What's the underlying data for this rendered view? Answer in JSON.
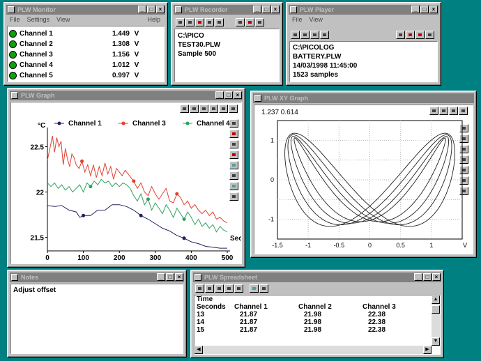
{
  "meter": {
    "title": "PLW Monitor",
    "menu": [
      "File",
      "Settings",
      "View"
    ],
    "menu_right": "Help",
    "channels": [
      {
        "label": "Channel 1",
        "value": "1.449",
        "unit": "V"
      },
      {
        "label": "Channel 2",
        "value": "1.308",
        "unit": "V"
      },
      {
        "label": "Channel 3",
        "value": "1.156",
        "unit": "V"
      },
      {
        "label": "Channel 4",
        "value": "1.012",
        "unit": "V"
      },
      {
        "label": "Channel 5",
        "value": "0.997",
        "unit": "V"
      }
    ]
  },
  "recorder": {
    "title": "PLW Recorder",
    "lines": [
      "C:\\PICO",
      "TEST30.PLW",
      "Sample 500"
    ]
  },
  "player": {
    "title": "PLW Player",
    "menu": [
      "File",
      "View"
    ],
    "lines": [
      "C:\\PICOLOG",
      "BATTERY.PLW",
      "14/03/1998 11:45:00",
      "1523 samples"
    ]
  },
  "graph": {
    "title": "PLW Graph",
    "unit_label": "°C",
    "legend": [
      {
        "name": "Channel 1",
        "color": "#202060"
      },
      {
        "name": "Channel 3",
        "color": "#e04030"
      },
      {
        "name": "Channel 4",
        "color": "#30a060"
      }
    ],
    "x_axis_label": "Sec",
    "chart_data": {
      "type": "line",
      "title": "",
      "xlabel": "Sec",
      "ylabel": "°C",
      "xlim": [
        0,
        500
      ],
      "ylim": [
        21.35,
        22.65
      ],
      "x_ticks": [
        "0",
        "100",
        "200",
        "300",
        "400",
        "500"
      ],
      "y_ticks": [
        "21.5",
        "22",
        "22.5"
      ],
      "series": [
        {
          "name": "Channel 3",
          "color": "#e04030",
          "x": [
            0,
            8,
            14,
            20,
            26,
            32,
            38,
            44,
            50,
            56,
            62,
            68,
            74,
            80,
            88,
            96,
            104,
            112,
            120,
            128,
            136,
            144,
            152,
            160,
            168,
            176,
            184,
            192,
            200,
            208,
            216,
            224,
            232,
            240,
            250,
            260,
            270,
            280,
            290,
            300,
            310,
            320,
            330,
            340,
            350,
            360,
            370,
            380,
            390,
            400,
            410,
            420,
            430,
            440,
            450,
            460,
            470,
            480,
            490,
            500
          ],
          "y": [
            22.35,
            22.5,
            22.62,
            22.44,
            22.6,
            22.5,
            22.56,
            22.3,
            22.48,
            22.36,
            22.28,
            22.42,
            22.38,
            22.3,
            22.26,
            22.34,
            22.22,
            22.3,
            22.18,
            22.3,
            22.16,
            22.28,
            22.18,
            22.32,
            22.2,
            22.28,
            22.14,
            22.26,
            22.22,
            22.18,
            22.24,
            22.2,
            22.16,
            22.12,
            22.04,
            22.1,
            22.0,
            21.96,
            22.06,
            21.98,
            21.92,
            21.98,
            22.04,
            21.9,
            21.88,
            21.98,
            21.94,
            21.86,
            21.9,
            21.82,
            21.86,
            21.8,
            21.76,
            21.8,
            21.74,
            21.78,
            21.7,
            21.72,
            21.68,
            21.66
          ]
        },
        {
          "name": "Channel 4",
          "color": "#30a060",
          "x": [
            0,
            10,
            20,
            30,
            40,
            50,
            60,
            70,
            80,
            90,
            100,
            110,
            120,
            130,
            140,
            150,
            160,
            170,
            180,
            190,
            200,
            210,
            220,
            230,
            240,
            250,
            260,
            270,
            280,
            290,
            300,
            310,
            320,
            330,
            340,
            350,
            360,
            370,
            380,
            390,
            400,
            410,
            420,
            430,
            440,
            450,
            460,
            470,
            480,
            490,
            500
          ],
          "y": [
            22.1,
            22.06,
            22.1,
            22.04,
            22.08,
            22.02,
            22.06,
            22.0,
            22.04,
            22.08,
            22.0,
            22.1,
            22.06,
            22.12,
            22.08,
            22.14,
            22.1,
            22.12,
            22.06,
            22.1,
            22.06,
            22.1,
            22.08,
            22.04,
            21.96,
            21.9,
            21.98,
            21.86,
            21.92,
            21.8,
            21.88,
            21.82,
            21.76,
            21.86,
            21.8,
            21.72,
            21.82,
            21.76,
            21.7,
            21.78,
            21.72,
            21.64,
            21.7,
            21.62,
            21.66,
            21.6,
            21.64,
            21.56,
            21.62,
            21.58,
            21.56
          ]
        },
        {
          "name": "Channel 1",
          "color": "#202060",
          "x": [
            0,
            20,
            40,
            60,
            80,
            90,
            100,
            120,
            140,
            160,
            180,
            200,
            220,
            240,
            260,
            280,
            300,
            320,
            340,
            360,
            380,
            400,
            420,
            440,
            460,
            480,
            500
          ],
          "y": [
            21.85,
            21.84,
            21.85,
            21.8,
            21.78,
            21.72,
            21.74,
            21.74,
            21.8,
            21.8,
            21.86,
            21.86,
            21.84,
            21.8,
            21.74,
            21.7,
            21.65,
            21.6,
            21.57,
            21.52,
            21.49,
            21.45,
            21.43,
            21.4,
            21.39,
            21.38,
            21.38
          ]
        }
      ]
    }
  },
  "xy_graph": {
    "title": "PLW XY Graph",
    "readout": "1.237  0.614",
    "chart_data": {
      "type": "line",
      "title": "",
      "xlabel": "V",
      "ylabel": "",
      "xlim": [
        -1.5,
        1.5
      ],
      "ylim": [
        -1.5,
        1.5
      ],
      "x_ticks": [
        "-1.5",
        "-1",
        "-0.5",
        "0",
        "0.5",
        "1",
        "V"
      ],
      "y_ticks": [
        "1",
        "0",
        "-1"
      ],
      "curves": [
        {
          "amp_x": 1.38,
          "amp_y": 1.18,
          "phase": 0.3
        },
        {
          "amp_x": 1.33,
          "amp_y": 1.14,
          "phase": 0.42
        },
        {
          "amp_x": 1.28,
          "amp_y": 1.1,
          "phase": 0.54
        },
        {
          "amp_x": 1.23,
          "amp_y": 1.06,
          "phase": 0.66
        }
      ]
    }
  },
  "notes": {
    "title": "Notes",
    "text": "Adjust offset"
  },
  "spreadsheet": {
    "title": "PLW Spreadsheet",
    "header1": [
      "Time",
      "",
      "",
      ""
    ],
    "header2": [
      "Seconds",
      "Channel 1",
      "Channel 2",
      "Channel 3"
    ],
    "rows": [
      [
        "13",
        "21.87",
        "21.98",
        "22.38"
      ],
      [
        "14",
        "21.87",
        "21.98",
        "22.38"
      ],
      [
        "15",
        "21.87",
        "21.98",
        "22.38"
      ]
    ]
  }
}
